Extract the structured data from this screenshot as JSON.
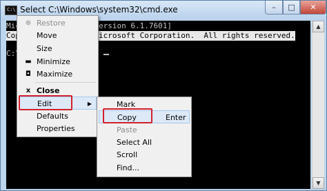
{
  "window": {
    "title": "Select C:\\Windows\\system32\\cmd.exe",
    "icon_name": "cmd-icon",
    "icon_text": "C:\\",
    "controls": {
      "minimize": "–",
      "maximize": "□",
      "close": "✕"
    }
  },
  "console": {
    "lines": [
      {
        "text": "Mic",
        "selected": false
      },
      {
        "text": "Cop",
        "selected": true
      },
      {
        "text": "C:\\",
        "selected": false
      }
    ],
    "right_fragments": [
      "ersion 6.1.7601]",
      "icrosoft Corporation.  All rights reserved."
    ]
  },
  "system_menu": {
    "items": [
      {
        "label": "Restore",
        "symbol": "⊕",
        "disabled": true
      },
      {
        "label": "Move",
        "symbol": "",
        "disabled": false
      },
      {
        "label": "Size",
        "symbol": "",
        "disabled": false
      },
      {
        "label": "Minimize",
        "symbol": "▬",
        "disabled": false
      },
      {
        "label": "Maximize",
        "symbol": "◘",
        "disabled": false
      },
      {
        "label": "Close",
        "symbol": "x",
        "disabled": false,
        "bold": true
      },
      {
        "label": "Edit",
        "symbol": "",
        "disabled": false,
        "highlighted": true,
        "submenu": true
      },
      {
        "label": "Defaults",
        "symbol": "",
        "disabled": false
      },
      {
        "label": "Properties",
        "symbol": "",
        "disabled": false
      }
    ],
    "submenu_arrow": "▶"
  },
  "edit_menu": {
    "items": [
      {
        "label": "Mark",
        "shortcut": "",
        "disabled": false
      },
      {
        "label": "Copy",
        "shortcut": "Enter",
        "disabled": false,
        "highlighted": true
      },
      {
        "label": "Paste",
        "shortcut": "",
        "disabled": true
      },
      {
        "label": "Select All",
        "shortcut": "",
        "disabled": false
      },
      {
        "label": "Scroll",
        "shortcut": "",
        "disabled": false
      },
      {
        "label": "Find...",
        "shortcut": "",
        "disabled": false
      }
    ]
  },
  "colors": {
    "annotation_red": "#d2202c",
    "console_bg": "#000000",
    "console_text": "#c0c0c0",
    "menu_highlight": "#dde9f7"
  }
}
